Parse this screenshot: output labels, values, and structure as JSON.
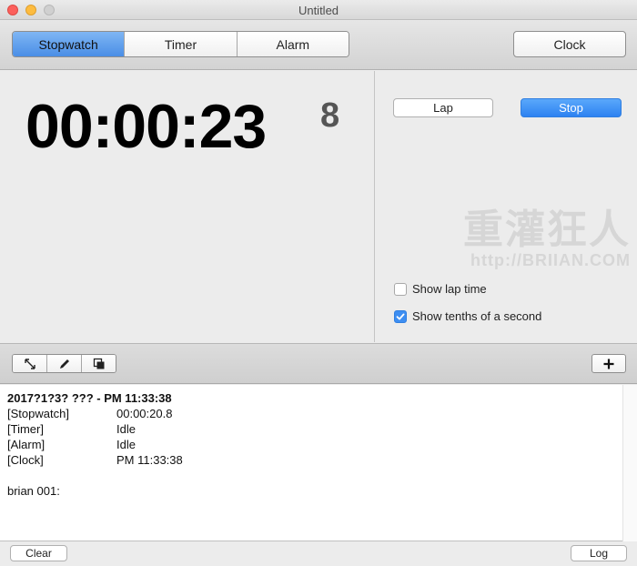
{
  "window": {
    "title": "Untitled"
  },
  "toolbar": {
    "tabs": [
      {
        "label": "Stopwatch",
        "active": true
      },
      {
        "label": "Timer",
        "active": false
      },
      {
        "label": "Alarm",
        "active": false
      }
    ],
    "clock_label": "Clock"
  },
  "stopwatch": {
    "time": "00:00:23",
    "tenths": "8",
    "lap_label": "Lap",
    "stop_label": "Stop",
    "show_lap_time": {
      "label": "Show lap time",
      "checked": false
    },
    "show_tenths": {
      "label": "Show tenths of a second",
      "checked": true
    }
  },
  "watermark": {
    "logo": "重灌狂人",
    "url": "http://BRIIAN.COM"
  },
  "bottom_toolbar": {
    "icons": [
      "resize-icon",
      "pencil-icon",
      "window-icon"
    ],
    "add_icon": "plus-icon"
  },
  "log": {
    "header": "2017?1?3? ??? - PM  11:33:38",
    "rows": [
      {
        "key": "[Stopwatch]",
        "value": "00:00:20.8"
      },
      {
        "key": "[Timer]",
        "value": "Idle"
      },
      {
        "key": "[Alarm]",
        "value": "Idle"
      },
      {
        "key": "[Clock]",
        "value": "PM  11:33:38"
      }
    ],
    "note": "brian 001:"
  },
  "footer": {
    "clear_label": "Clear",
    "log_label": "Log"
  },
  "colors": {
    "accent": "#3d8ef2",
    "tab_active": "#6aa8f0",
    "stop_button": "#2d82f1"
  }
}
